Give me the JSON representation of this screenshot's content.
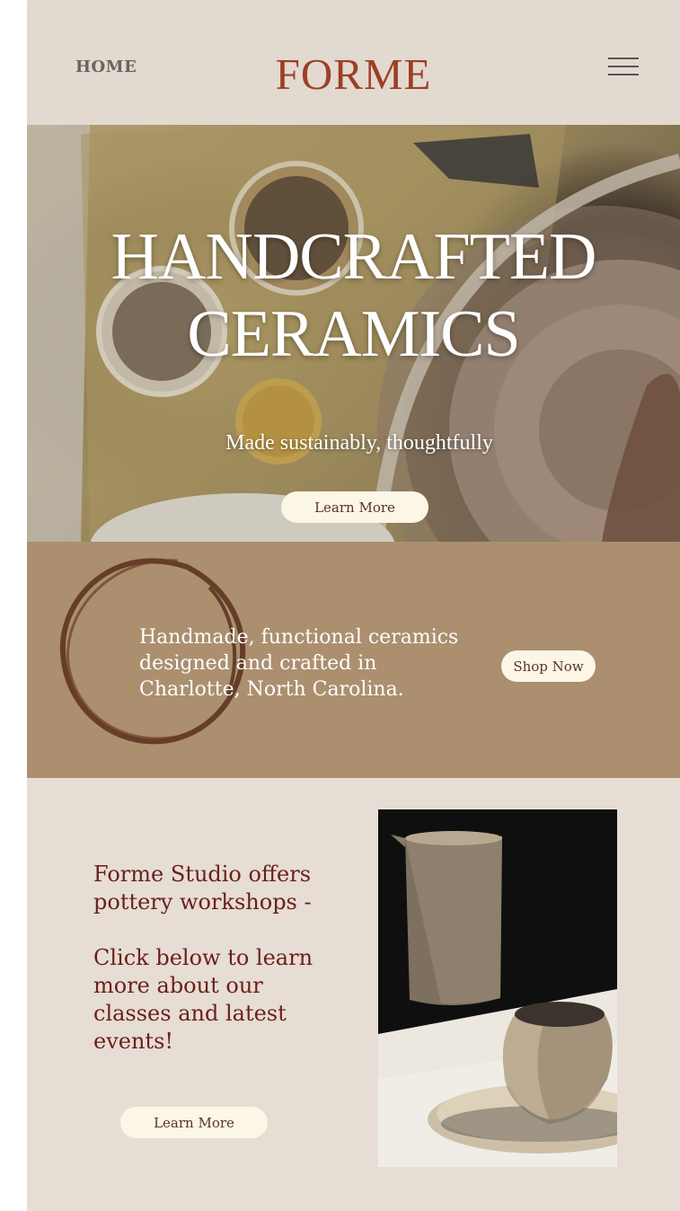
{
  "header": {
    "home_label": "HOME",
    "brand": "FORME",
    "menu_icon": "hamburger-menu-icon"
  },
  "hero": {
    "title_line1": "HANDCRAFTED",
    "title_line2": "CERAMICS",
    "subtitle": "Made sustainably, thoughtfully",
    "button_label": "Learn More",
    "image": "pottery-wheel-and-tools-photo"
  },
  "band": {
    "text": "Handmade, functional ceramics designed and crafted in Charlotte, North Carolina.",
    "button_label": "Shop Now",
    "decoration": "brush-circle-ring"
  },
  "workshops": {
    "text_p1": "Forme Studio offers pottery workshops -",
    "text_p2": "Click below to learn more about our classes and latest events!",
    "button_label": "Learn More",
    "image": "ceramic-pitcher-and-cup-photo"
  },
  "colors": {
    "brand": "#9c3f25",
    "header_bg": "#e2d9d0",
    "band_bg": "#ab8f6f",
    "section_bg": "#e6ddd4",
    "button_bg": "#fcf6e6",
    "workshop_text": "#6b1f1b"
  }
}
